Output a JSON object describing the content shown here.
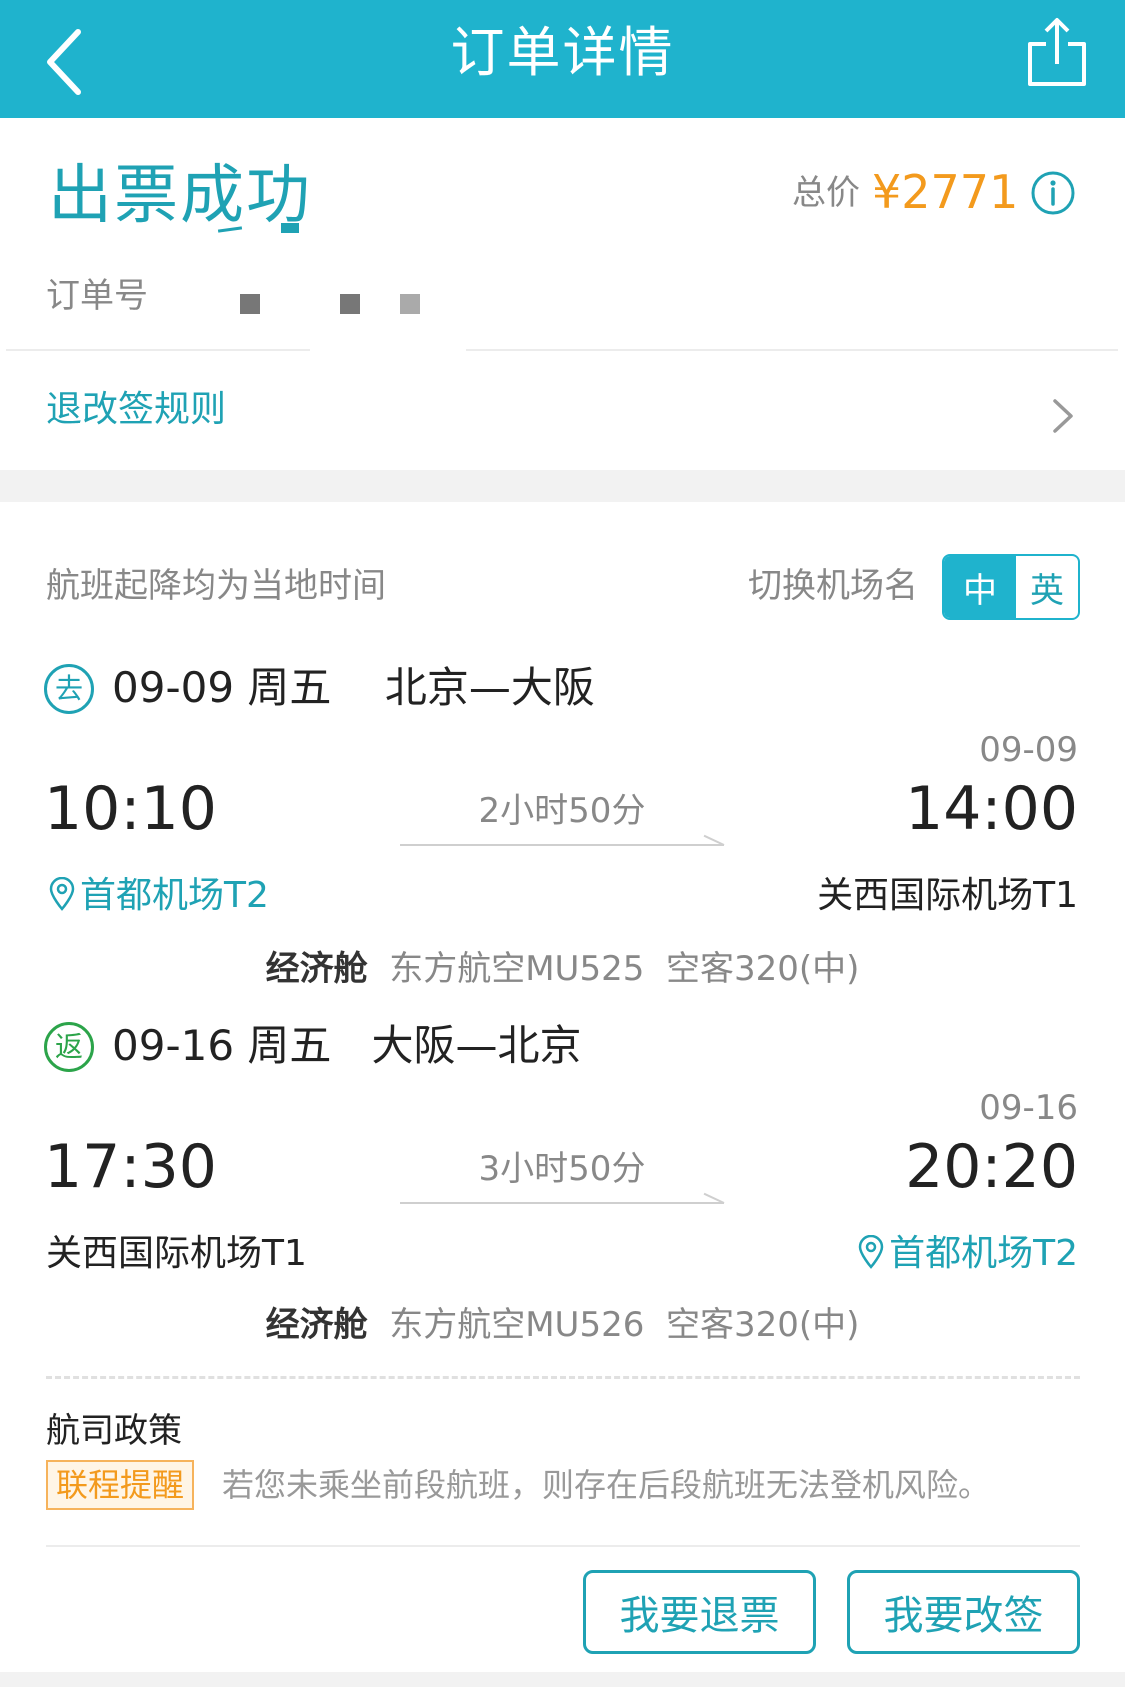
{
  "nav": {
    "title": "订单详情",
    "back_icon": "chevron-left-icon",
    "share_icon": "share-icon",
    "bar_color": "#1fb3cd"
  },
  "order": {
    "status": "出票成功",
    "price_label": "总价",
    "price_value": "¥2771",
    "price_color": "#f39a1d",
    "order_no_label": "订单号"
  },
  "rules": {
    "label": "退改签规则"
  },
  "flight_info": {
    "tz_note": "航班起降均为当地时间",
    "switch_label": "切换机场名",
    "lang_options": [
      "中",
      "英"
    ],
    "lang_selected": "中"
  },
  "segments": [
    {
      "badge": "去",
      "date": "09-09",
      "weekday": "周五",
      "route": "北京—大阪",
      "dep_time": "10:10",
      "arr_date": "09-09",
      "arr_time": "14:00",
      "duration": "2小时50分",
      "dep_airport": "首都机场T2",
      "arr_airport": "关西国际机场T1",
      "cabin": "经济舱",
      "airline_flight": "东方航空MU525",
      "aircraft": "空客320(中)"
    },
    {
      "badge": "返",
      "date": "09-16",
      "weekday": "周五",
      "route": "大阪—北京",
      "dep_time": "17:30",
      "arr_date": "09-16",
      "arr_time": "20:20",
      "duration": "3小时50分",
      "dep_airport": "关西国际机场T1",
      "arr_airport": "首都机场T2",
      "cabin": "经济舱",
      "airline_flight": "东方航空MU526",
      "aircraft": "空客320(中)"
    }
  ],
  "policy": {
    "title": "航司政策",
    "tag": "联程提醒",
    "text": "若您未乘坐前段航班，则存在后段航班无法登机风险。"
  },
  "actions": {
    "refund": "我要退票",
    "change": "我要改签"
  }
}
